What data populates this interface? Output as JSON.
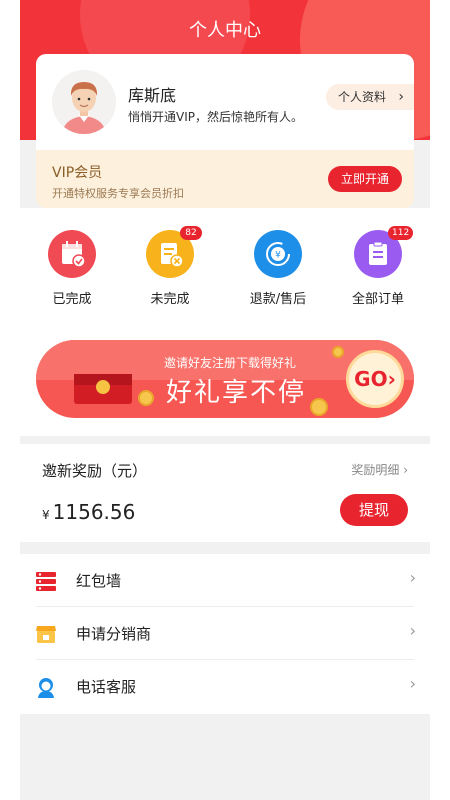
{
  "header": {
    "title": "个人中心"
  },
  "profile": {
    "name": "库斯底",
    "desc": "悄悄开通VIP，然后惊艳所有人。",
    "profile_btn": "个人资料",
    "chevron": "›"
  },
  "vip": {
    "title": "VIP会员",
    "desc": "开通特权服务专享会员折扣",
    "button": "立即开通"
  },
  "orders": [
    {
      "label": "已完成",
      "icon": "calendar-check-icon",
      "color": "#f04a55",
      "badge": ""
    },
    {
      "label": "未完成",
      "icon": "document-cancel-icon",
      "color": "#f8b21c",
      "badge": "82"
    },
    {
      "label": "退款/售后",
      "icon": "refund-icon",
      "color": "#1e8fe8",
      "badge": ""
    },
    {
      "label": "全部订单",
      "icon": "clipboard-icon",
      "color": "#9a5cf0",
      "badge": "112"
    }
  ],
  "banner": {
    "top_text": "邀请好友注册下载得好礼",
    "main_text": "好礼享不停",
    "go_text": "GO›"
  },
  "reward": {
    "title": "邀新奖励（元）",
    "detail": "奖励明细 ›",
    "currency": "¥",
    "amount": "1156.56",
    "withdraw": "提现"
  },
  "menu": [
    {
      "label": "红包墙",
      "icon": "red-envelope-wall-icon"
    },
    {
      "label": "申请分销商",
      "icon": "shop-icon"
    },
    {
      "label": "电话客服",
      "icon": "customer-service-icon"
    }
  ],
  "colors": {
    "brand_red": "#e8242f",
    "header_red": "#f2343a"
  }
}
